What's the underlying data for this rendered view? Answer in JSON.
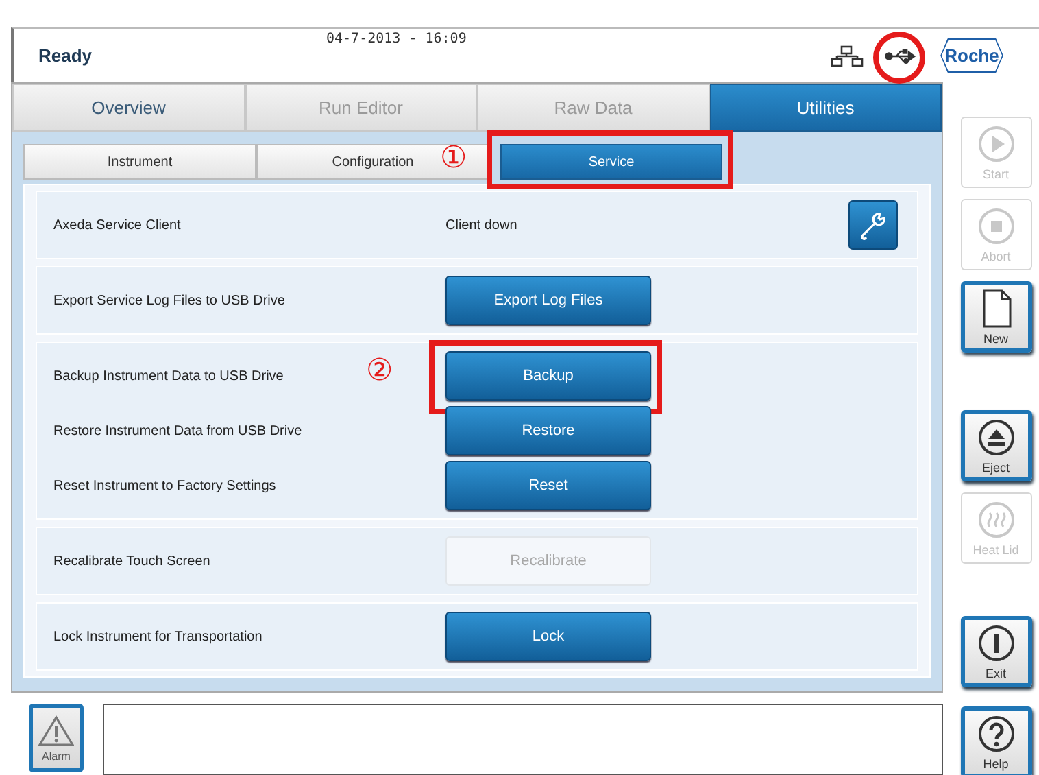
{
  "header": {
    "status": "Ready",
    "datetime": "04-7-2013 - 16:09",
    "usb_highlighted": true,
    "logo": "Roche"
  },
  "main_tabs": [
    {
      "label": "Overview",
      "selected": false,
      "disabled": false
    },
    {
      "label": "Run Editor",
      "selected": false,
      "disabled": true
    },
    {
      "label": "Raw Data",
      "selected": false,
      "disabled": true
    },
    {
      "label": "Utilities",
      "selected": true,
      "disabled": false
    }
  ],
  "sub_tabs": [
    {
      "label": "Instrument",
      "selected": false
    },
    {
      "label": "Configuration",
      "selected": false
    },
    {
      "label": "Service",
      "selected": true,
      "highlighted": true,
      "callout": "①"
    }
  ],
  "sections": [
    {
      "rows": [
        {
          "kind": "status",
          "label": "Axeda Service Client",
          "value": "Client down"
        }
      ]
    },
    {
      "rows": [
        {
          "kind": "button",
          "label": "Export Service Log Files to USB Drive",
          "button": "Export Log Files",
          "disabled": false
        }
      ]
    },
    {
      "rows": [
        {
          "kind": "button",
          "label": "Backup Instrument Data to USB Drive",
          "button": "Backup",
          "disabled": false,
          "highlighted": true,
          "callout": "②"
        },
        {
          "kind": "button",
          "label": "Restore Instrument Data from USB Drive",
          "button": "Restore",
          "disabled": false
        },
        {
          "kind": "button",
          "label": "Reset Instrument to Factory Settings",
          "button": "Reset",
          "disabled": false
        }
      ]
    },
    {
      "rows": [
        {
          "kind": "button",
          "label": "Recalibrate Touch Screen",
          "button": "Recalibrate",
          "disabled": true
        }
      ]
    },
    {
      "rows": [
        {
          "kind": "button",
          "label": "Lock Instrument for Transportation",
          "button": "Lock",
          "disabled": false
        }
      ]
    }
  ],
  "side_buttons": [
    {
      "kind": "start",
      "label": "Start",
      "disabled": true
    },
    {
      "kind": "abort",
      "label": "Abort",
      "disabled": true
    },
    {
      "kind": "new",
      "label": "New",
      "disabled": false
    },
    {
      "kind": "eject",
      "label": "Eject",
      "disabled": false
    },
    {
      "kind": "heat",
      "label": "Heat Lid",
      "disabled": true
    },
    {
      "kind": "exit",
      "label": "Exit",
      "disabled": false
    },
    {
      "kind": "help",
      "label": "Help",
      "disabled": false
    }
  ],
  "alarm_button": {
    "label": "Alarm",
    "disabled": false
  }
}
